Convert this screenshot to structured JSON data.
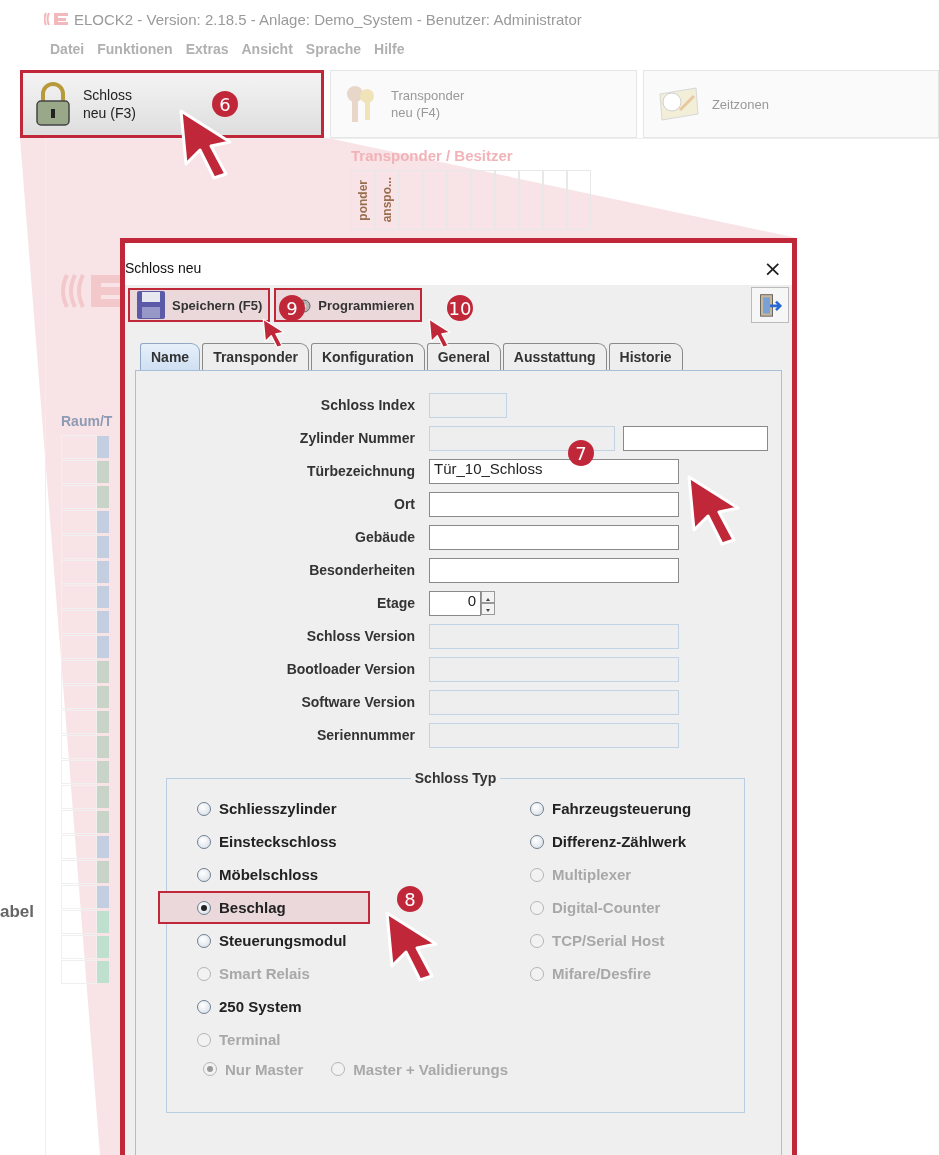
{
  "app": {
    "title": "ELOCK2 - Version: 2.18.5 - Anlage: Demo_System - Benutzer: Administrator",
    "menu": [
      "Datei",
      "Funktionen",
      "Extras",
      "Ansicht",
      "Sprache",
      "Hilfe"
    ],
    "toolbar": [
      {
        "kind": "lock",
        "label": "Schloss",
        "sublabel": "neu (F3)",
        "highlighted": true
      },
      {
        "kind": "keys",
        "label": "Transponder",
        "sublabel": "neu (F4)",
        "highlighted": false
      },
      {
        "kind": "clock",
        "label": "Zeitzonen",
        "highlighted": false
      }
    ],
    "panel": {
      "section_title": "Transponder / Besitzer",
      "column_headers": [
        "ponder",
        "anspo..."
      ],
      "table_header": "Raum/T",
      "rows": [
        {
          "color": "#c3cfe0"
        },
        {
          "color": "#c8d4c8"
        },
        {
          "color": "#c8d4c8"
        },
        {
          "color": "#c3cfe0"
        },
        {
          "color": "#c3cfe0"
        },
        {
          "color": "#c3cfe0"
        },
        {
          "color": "#c3cfe0"
        },
        {
          "color": "#c3cfe0"
        },
        {
          "color": "#c3cfe0"
        },
        {
          "color": "#c8d4c8"
        },
        {
          "color": "#c8d4c8"
        },
        {
          "color": "#c8d4c8"
        },
        {
          "color": "#c8d4c8"
        },
        {
          "color": "#c8d4c8"
        },
        {
          "color": "#c8d4c8"
        },
        {
          "color": "#c8d4c8"
        },
        {
          "color": "#c3cfe0"
        },
        {
          "color": "#c8d4c8"
        },
        {
          "color": "#c3cfe0"
        },
        {
          "color": "#c0e0cf"
        },
        {
          "color": "#c0e0cf"
        },
        {
          "color": "#c0e0cf"
        }
      ]
    },
    "side_label": "abel"
  },
  "dialog": {
    "title": "Schloss neu",
    "close": "×",
    "toolbar": [
      {
        "kind": "save",
        "label": "Speichern (F5)",
        "highlighted": true
      },
      {
        "kind": "program",
        "label": "Programmieren",
        "highlighted": true
      },
      {
        "kind": "exit"
      }
    ],
    "tabs": [
      {
        "label": "Name",
        "selected": true
      },
      {
        "label": "Transponder",
        "selected": false
      },
      {
        "label": "Konfiguration",
        "selected": false
      },
      {
        "label": "General",
        "selected": false
      },
      {
        "label": "Ausstattung",
        "selected": false
      },
      {
        "label": "Historie",
        "selected": false
      }
    ],
    "fields": [
      {
        "label": "Schloss Index",
        "kind": "short",
        "disabled": true
      },
      {
        "label": "Zylinder Nummer",
        "kind": "double",
        "disabled": true
      },
      {
        "label": "Türbezeichnung",
        "kind": "text",
        "value": "Tür_10_Schloss",
        "disabled": false
      },
      {
        "label": "Ort",
        "kind": "text",
        "disabled": false
      },
      {
        "label": "Gebäude",
        "kind": "text",
        "disabled": false
      },
      {
        "label": "Besonderheiten",
        "kind": "text",
        "disabled": false
      },
      {
        "label": "Etage",
        "kind": "spinner",
        "value": "0",
        "disabled": false
      },
      {
        "label": "Schloss Version",
        "kind": "text",
        "disabled": true
      },
      {
        "label": "Bootloader Version",
        "kind": "text",
        "disabled": true
      },
      {
        "label": "Software Version",
        "kind": "text",
        "disabled": true
      },
      {
        "label": "Seriennummer",
        "kind": "text",
        "disabled": true
      }
    ],
    "group": {
      "title": "Schloss Typ",
      "left": [
        {
          "label": "Schliesszylinder",
          "selected": false,
          "disabled": false,
          "highlighted": false
        },
        {
          "label": "Einsteckschloss",
          "selected": false,
          "disabled": false,
          "highlighted": false
        },
        {
          "label": "Möbelschloss",
          "selected": false,
          "disabled": false,
          "highlighted": false
        },
        {
          "label": "Beschlag",
          "selected": true,
          "disabled": false,
          "highlighted": true
        },
        {
          "label": "Steuerungsmodul",
          "selected": false,
          "disabled": false,
          "highlighted": false
        },
        {
          "label": "Smart Relais",
          "selected": false,
          "disabled": true,
          "highlighted": false
        },
        {
          "label": "250 System",
          "selected": false,
          "disabled": false,
          "highlighted": false
        },
        {
          "label": "Terminal",
          "selected": false,
          "disabled": true,
          "highlighted": false
        }
      ],
      "right": [
        {
          "label": "Fahrzeugsteuerung",
          "selected": false,
          "disabled": false,
          "highlighted": false
        },
        {
          "label": "Differenz-Zählwerk",
          "selected": false,
          "disabled": false,
          "highlighted": false
        },
        {
          "label": "Multiplexer",
          "selected": false,
          "disabled": true,
          "highlighted": false
        },
        {
          "label": "Digital-Counter",
          "selected": false,
          "disabled": true,
          "highlighted": false
        },
        {
          "label": "TCP/Serial Host",
          "selected": false,
          "disabled": true,
          "highlighted": false
        },
        {
          "label": "Mifare/Desfire",
          "selected": false,
          "disabled": true,
          "highlighted": false
        }
      ],
      "sub_options": [
        {
          "label": "Nur Master",
          "selected": true,
          "disabled": true
        },
        {
          "label": "Master + Validierungs",
          "selected": false,
          "disabled": true
        }
      ]
    }
  },
  "markers": [
    "6",
    "7",
    "8",
    "9",
    "10"
  ]
}
